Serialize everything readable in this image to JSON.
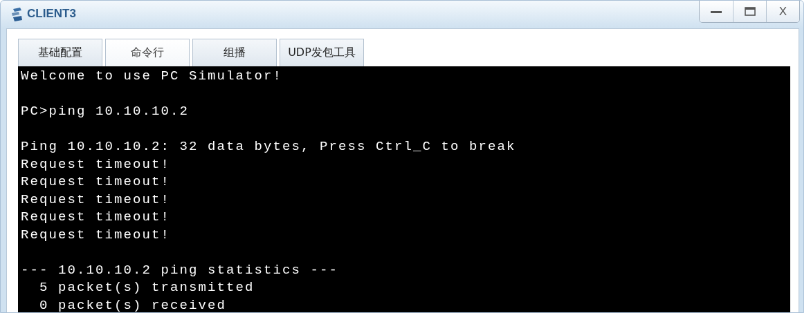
{
  "window": {
    "title": "CLIENT3",
    "controls": [
      {
        "kind": "minimize"
      },
      {
        "kind": "maximize"
      },
      {
        "kind": "close",
        "label": "X"
      }
    ]
  },
  "tabs": [
    {
      "label": "基础配置",
      "selected": false
    },
    {
      "label": "命令行",
      "selected": true
    },
    {
      "label": "组播",
      "selected": false
    },
    {
      "label": "UDP发包工具",
      "selected": false
    }
  ],
  "terminal": {
    "blocks": [
      [
        "Welcome to use PC Simulator!"
      ],
      [
        "PC>ping 10.10.10.2"
      ],
      [
        "Ping 10.10.10.2: 32 data bytes, Press Ctrl_C to break",
        "Request timeout!",
        "Request timeout!",
        "Request timeout!",
        "Request timeout!",
        "Request timeout!"
      ],
      [
        "--- 10.10.10.2 ping statistics ---",
        "  5 packet(s) transmitted",
        "  0 packet(s) received"
      ]
    ]
  }
}
